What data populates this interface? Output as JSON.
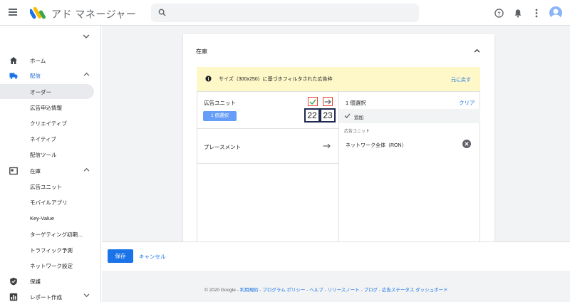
{
  "app": {
    "title": "アド マネージャー"
  },
  "header": {
    "icons": [
      "hamburger-icon",
      "search-icon",
      "help-icon",
      "bell-icon",
      "more-vert-icon"
    ]
  },
  "sidebar": {
    "items": [
      {
        "label": "ホーム",
        "icon": "home-icon"
      },
      {
        "label": "配信",
        "icon": "truck-icon",
        "active": true
      },
      {
        "label": "オーダー",
        "sub": true,
        "active": true
      },
      {
        "label": "広告申込情報",
        "sub": true
      },
      {
        "label": "クリエイティブ",
        "sub": true
      },
      {
        "label": "ネイティブ",
        "sub": true
      },
      {
        "label": "配信ツール",
        "sub": true
      },
      {
        "label": "在庫",
        "icon": "inventory-icon"
      },
      {
        "label": "広告ユニット",
        "sub": true
      },
      {
        "label": "モバイルアプリ",
        "sub": true
      },
      {
        "label": "Key-Value",
        "sub": true
      },
      {
        "label": "ターゲティング初期...",
        "sub": true
      },
      {
        "label": "トラフィック予測",
        "sub": true
      },
      {
        "label": "ネットワーク設定",
        "sub": true
      },
      {
        "label": "保護",
        "icon": "shield-icon"
      },
      {
        "label": "レポート作成",
        "icon": "chart-icon"
      }
    ]
  },
  "card": {
    "title": "在庫",
    "banner": {
      "text": "サイズ（300x250）に基づきフィルタされた広告枠",
      "link": "元に戻す"
    },
    "left": {
      "label": "広告ユニット",
      "chip": "1 個選択",
      "num_a": "22",
      "num_b": "23",
      "row2": "プレースメント"
    },
    "right": {
      "head": "1 個選択",
      "clear": "クリア",
      "added": "追加",
      "category": "広告ユニット",
      "item": "ネットワーク全体（RON）"
    }
  },
  "actions": {
    "save": "保存",
    "cancel": "キャンセル"
  },
  "footer": {
    "copyright": "© 2020 Google - ",
    "links": [
      "利用規約",
      "プログラム ポリシー",
      "ヘルプ",
      "リリースノート",
      "ブログ",
      "広告ステータス ダッシュボード"
    ],
    "sep": " - "
  },
  "colors": {
    "accent": "#1a73e8",
    "banner": "#fef7c7",
    "highlight_red": "#ea4335",
    "highlight_navy": "#1f2a4d"
  }
}
